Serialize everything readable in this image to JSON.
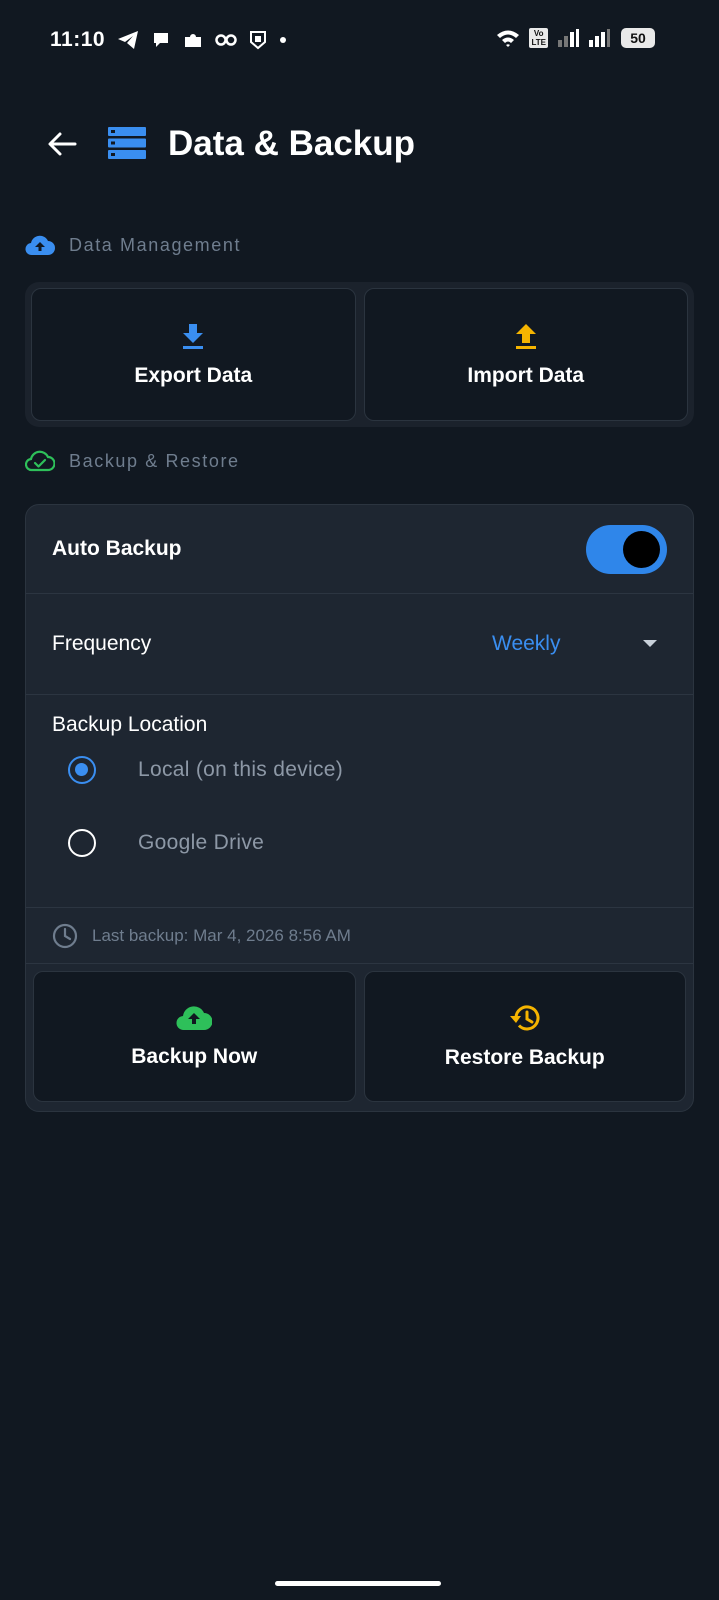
{
  "status_bar": {
    "time": "11:10",
    "battery": "50",
    "lte_label": "Vo LTE",
    "sim": "1"
  },
  "header": {
    "back_icon": "arrow-left-icon",
    "title_icon": "storage-icon",
    "title": "Data & Backup"
  },
  "data_management": {
    "section_label": "Data Management",
    "icon": "cloud-upload-icon",
    "export": {
      "label": "Export Data",
      "icon": "download-icon",
      "color": "#3a8ef0"
    },
    "import": {
      "label": "Import Data",
      "icon": "upload-icon",
      "color": "#f5b400"
    }
  },
  "backup_restore": {
    "section_label": "Backup & Restore",
    "icon": "cloud-check-icon",
    "auto_backup": {
      "label": "Auto Backup",
      "enabled": true
    },
    "frequency": {
      "label": "Frequency",
      "value": "Weekly"
    },
    "backup_location": {
      "title": "Backup Location",
      "options": [
        {
          "label": "Local (on this device)",
          "selected": true
        },
        {
          "label": "Google Drive",
          "selected": false
        }
      ]
    },
    "last_backup": "Last backup: Mar 4, 2026 8:56 AM",
    "backup_now": {
      "label": "Backup Now",
      "icon": "cloud-upload-icon",
      "color": "#2ec05a"
    },
    "restore_backup": {
      "label": "Restore Backup",
      "icon": "history-icon",
      "color": "#f5b400"
    }
  },
  "colors": {
    "background": "#111821",
    "accent": "#3a8ef0",
    "success": "#2ec05a",
    "warning": "#f5b400"
  }
}
